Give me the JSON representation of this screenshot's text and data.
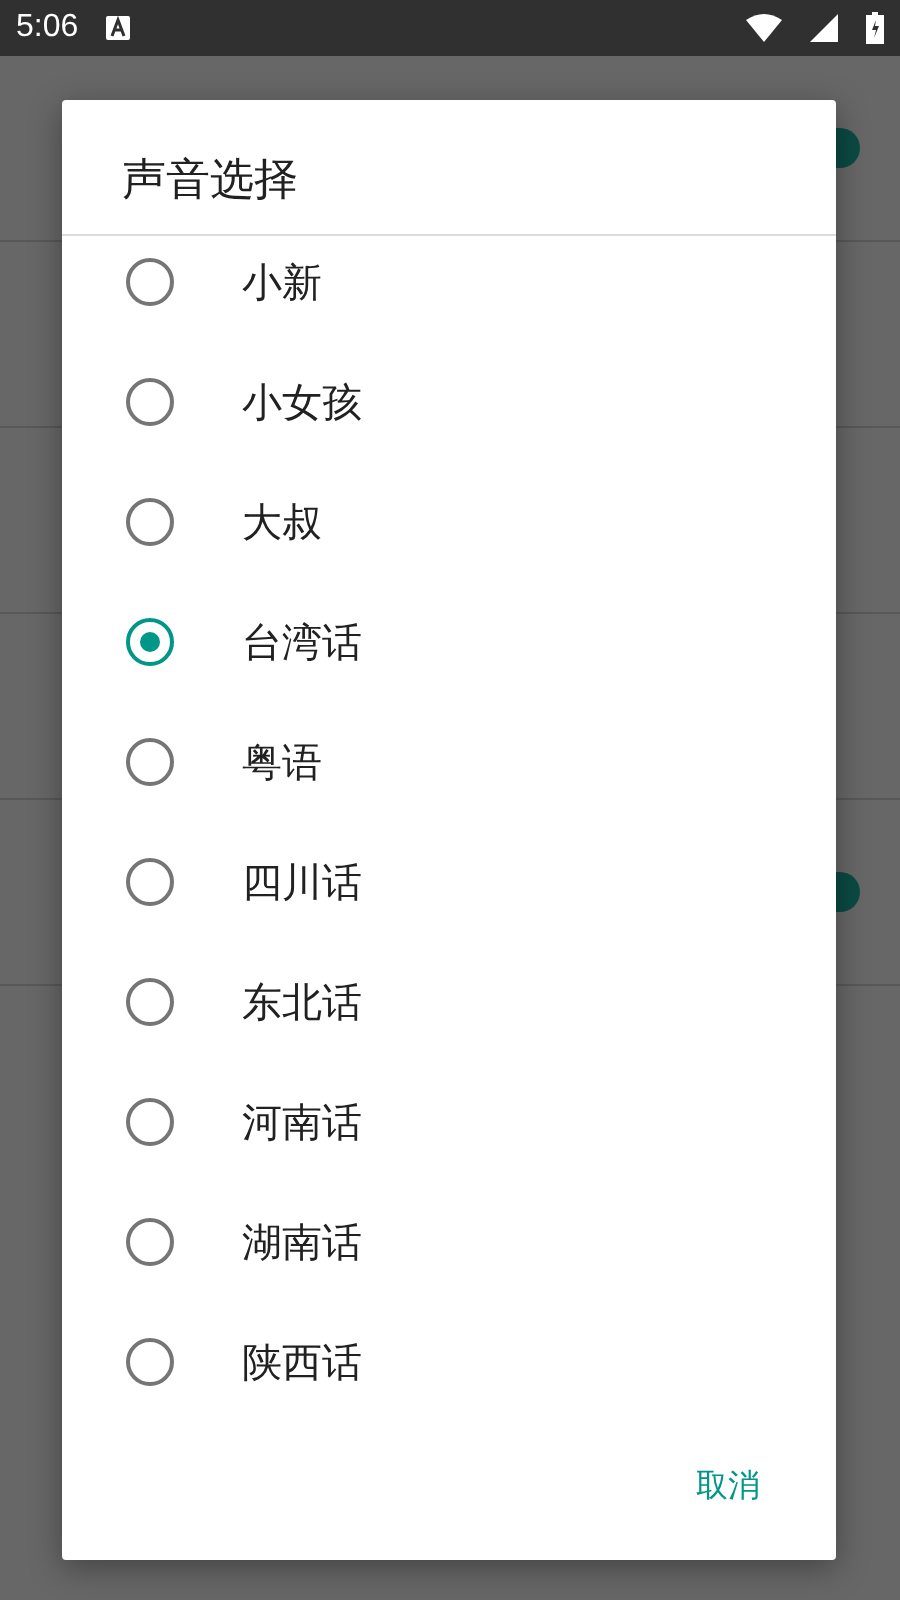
{
  "status_bar": {
    "time": "5:06"
  },
  "settings_rows": [
    {
      "kind": "switch",
      "on": true
    },
    {
      "kind": "plain"
    },
    {
      "kind": "plain"
    },
    {
      "kind": "plain"
    },
    {
      "kind": "switch",
      "on": true
    }
  ],
  "dialog": {
    "title": "声音选择",
    "options": [
      {
        "label": "小新",
        "selected": false
      },
      {
        "label": "小女孩",
        "selected": false
      },
      {
        "label": "大叔",
        "selected": false
      },
      {
        "label": "台湾话",
        "selected": true
      },
      {
        "label": "粤语",
        "selected": false
      },
      {
        "label": "四川话",
        "selected": false
      },
      {
        "label": "东北话",
        "selected": false
      },
      {
        "label": "河南话",
        "selected": false
      },
      {
        "label": "湖南话",
        "selected": false
      },
      {
        "label": "陕西话",
        "selected": false
      }
    ],
    "cancel_button": "取消"
  }
}
